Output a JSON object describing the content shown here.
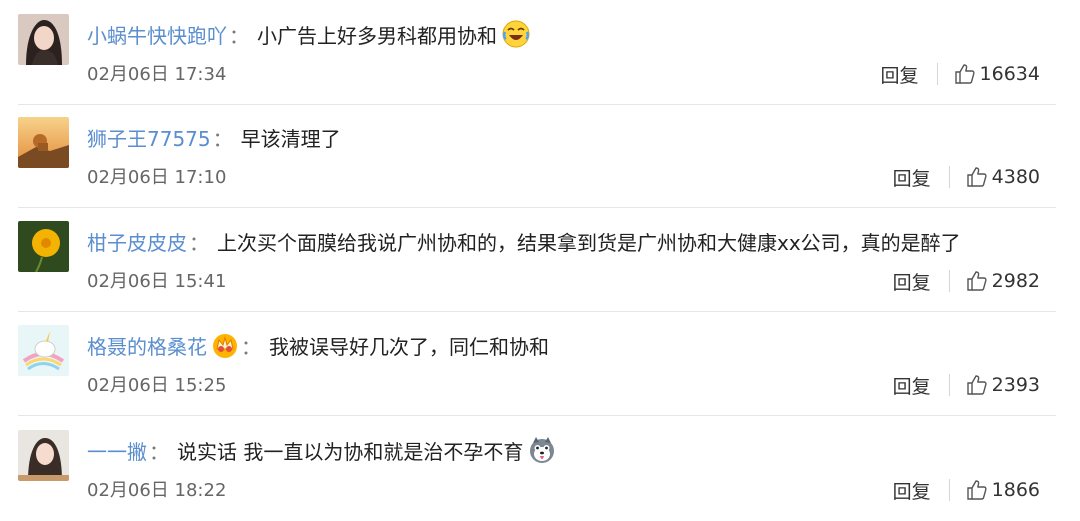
{
  "comments": [
    {
      "username": "小蜗牛快快跑吖",
      "colon": "：",
      "text": "小广告上好多男科都用协和",
      "emoji": "crying-laughing-emoji",
      "time": "02月06日 17:34",
      "reply_label": "回复",
      "likes": "16634"
    },
    {
      "username": "狮子王77575",
      "colon": "：",
      "text": "早该清理了",
      "time": "02月06日 17:10",
      "reply_label": "回复",
      "likes": "4380"
    },
    {
      "username": "柑子皮皮皮",
      "colon": "：",
      "text": "上次买个面膜给我说广州协和的，结果拿到货是广州协和大健康xx公司，真的是醉了",
      "time": "02月06日 15:41",
      "reply_label": "回复",
      "likes": "2982"
    },
    {
      "username": "格聂的格桑花",
      "colon": "：",
      "badge": "crown-badge",
      "text": "我被误导好几次了，同仁和协和",
      "time": "02月06日 15:25",
      "reply_label": "回复",
      "likes": "2393"
    },
    {
      "username": "一一撇",
      "colon": "：",
      "text": "说实话 我一直以为协和就是治不孕不育",
      "emoji": "husky-emoji",
      "time": "02月06日 18:22",
      "reply_label": "回复",
      "likes": "1866"
    }
  ],
  "colors": {
    "username": "#5b8ecf",
    "text": "#222222",
    "meta": "#666666",
    "divider": "#e6e6e6"
  }
}
